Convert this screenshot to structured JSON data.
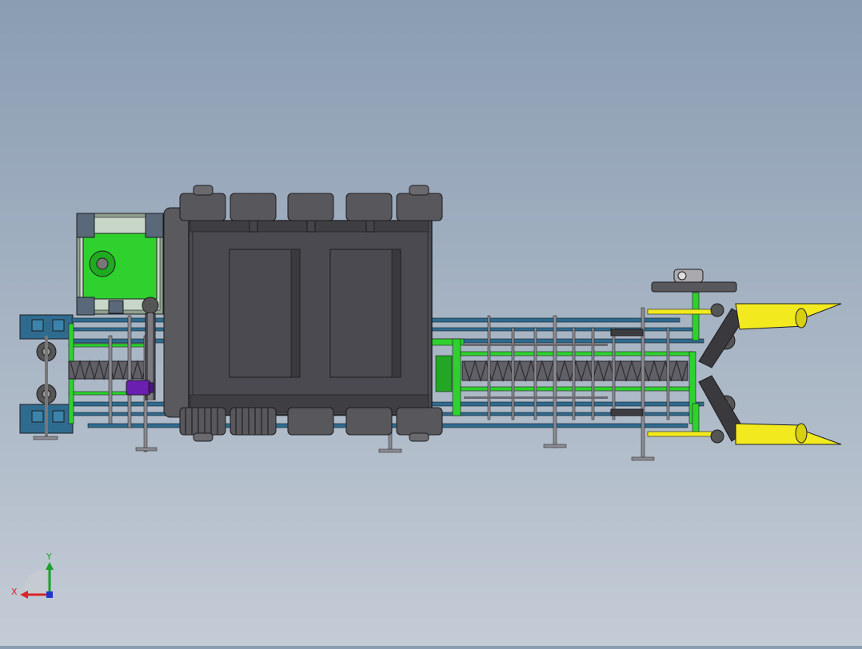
{
  "viewport": {
    "background_top": "#8a9db2",
    "background_bottom": "#c4ccd6"
  },
  "triad": {
    "x_label": "X",
    "y_label": "Y",
    "x_color": "#d8262a",
    "y_color": "#1aa12a",
    "z_color": "#2036c8"
  },
  "colors": {
    "frame_green": "#2fd12f",
    "frame_blue": "#2f6b8f",
    "body_gray": "#4b4a50",
    "wheel_gray": "#58575c",
    "fin_yellow": "#f2ea1f",
    "motor_purple": "#6a1fb0",
    "edge_dark": "#1c1c1f"
  },
  "icons": {
    "triad": "coordinate-triad-icon"
  }
}
